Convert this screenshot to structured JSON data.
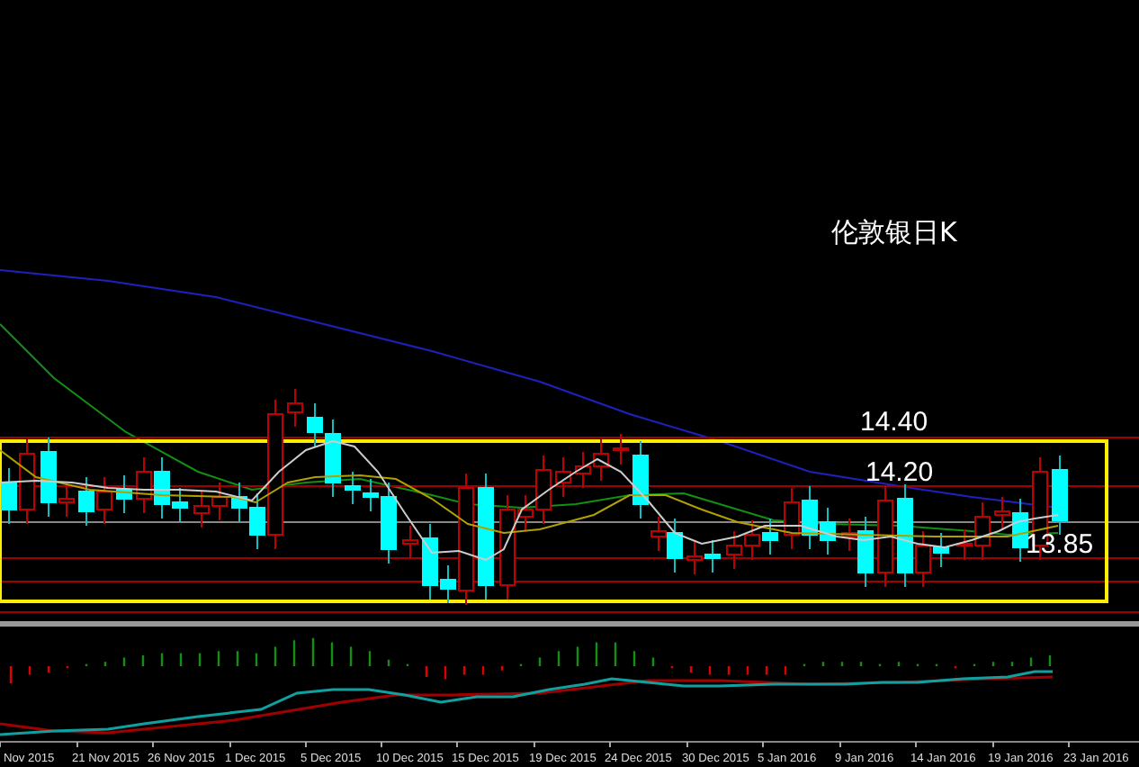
{
  "chart_title": "伦敦银日K",
  "price_labels": [
    {
      "kind": "resistance",
      "text": "14.40"
    },
    {
      "kind": "mid",
      "text": "14.20"
    },
    {
      "kind": "current",
      "text": "13.85"
    }
  ],
  "date_labels": [
    "Nov 2015",
    "21 Nov 2015",
    "26 Nov 2015",
    "1 Dec 2015",
    "5 Dec 2015",
    "10 Dec 2015",
    "15 Dec 2015",
    "19 Dec 2015",
    "24 Dec 2015",
    "30 Dec 2015",
    "5 Jan 2016",
    "9 Jan 2016",
    "14 Jan 2016",
    "19 Jan 2016",
    "23 Jan 2016"
  ]
}
